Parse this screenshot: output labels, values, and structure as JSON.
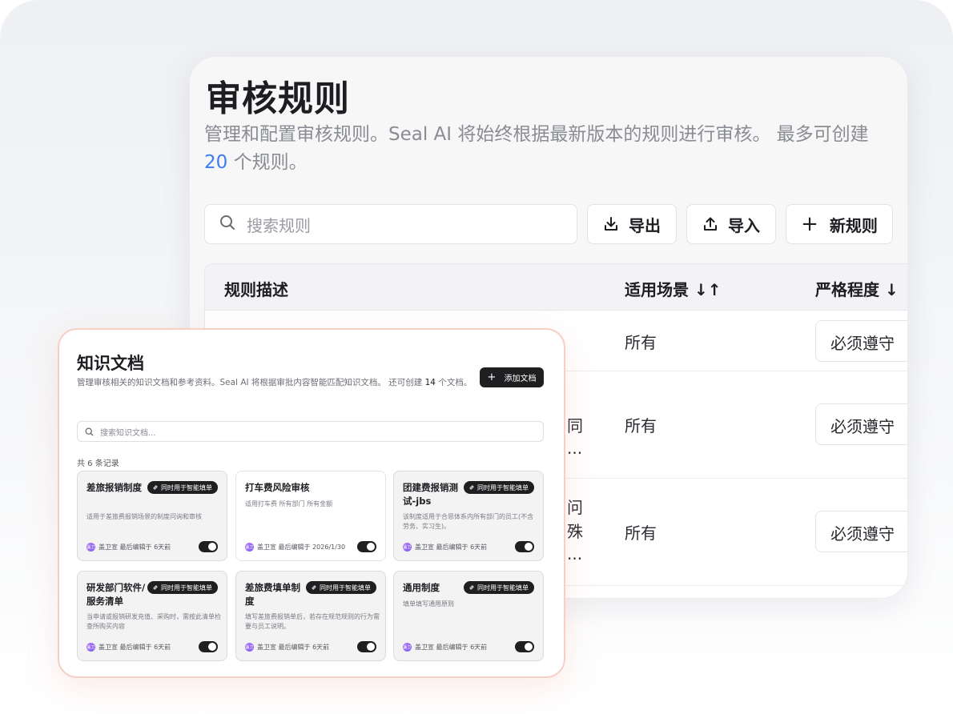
{
  "rules": {
    "title": "审核规则",
    "desc_line1": "管理和配置审核规则。Seal AI 将始终根据最新版本的规则进行审核。 最多可创建",
    "desc_count": "20",
    "desc_suffix": " 个规则。",
    "search_placeholder": "搜索规则",
    "export_label": "导出",
    "import_label": "导入",
    "new_label": "新规则",
    "new_plus": "+",
    "columns": {
      "desc": "规则描述",
      "scene": "适用场景 ↓↑",
      "level": "严格程度 ↓"
    },
    "rows": [
      {
        "scene": "所有",
        "level": "必须遵守"
      },
      {
        "scene": "所有",
        "level": "必须遵守",
        "desc_frag_1": "同",
        "desc_frag_2": "..."
      },
      {
        "scene": "所有",
        "level": "必须遵守",
        "desc_frag_1": "问",
        "desc_frag_2": "殊",
        "desc_frag_3": "..."
      }
    ]
  },
  "kb": {
    "title": "知识文档",
    "desc_a": "管理审核相关的知识文档和参考资料。Seal AI 将根据审批内容智能匹配知识文档。 还可创建 ",
    "desc_num": "14",
    "desc_b": " 个文档。",
    "add_label": "添加文档",
    "add_plus": "+",
    "search_placeholder": "搜索知识文档...",
    "count_text": "共 6 条记录",
    "badge_text": "同时用于智能填单",
    "avatar_initials": "盖卫",
    "docs": [
      {
        "title": "差旅报销制度",
        "sub": "适用于差旅费报销场景的制度问询和审核",
        "foot": "盖卫宣 最后编辑于 6天前"
      },
      {
        "title": "打车费风险审核",
        "sub": "适用打车费 所有部门 所有金额",
        "foot": "盖卫宣 最后编辑于 2026/1/30"
      },
      {
        "title": "团建费报销测试-jbs",
        "sub": "该制度适用于合思体系内所有部门的员工(不含劳务、实习生)。",
        "foot": "盖卫宣 最后编辑于 6天前"
      },
      {
        "title": "研发部门软件/服务清单",
        "sub": "当申请或报销研发充值、采购时，需按此清单检查所购买内容",
        "foot": "盖卫宣 最后编辑于 6天前"
      },
      {
        "title": "差旅费填单制度",
        "sub": "填写差旅费报销单后，若存在规范规则的行为需要与员工说明。",
        "foot": "盖卫宣 最后编辑于 6天前"
      },
      {
        "title": "通用制度",
        "sub": "填单填写通用原则",
        "foot": "盖卫宣 最后编辑于 6天前"
      }
    ]
  },
  "icons": [
    "search-icon",
    "download-icon",
    "upload-icon",
    "plus-icon",
    "link-icon",
    "toggle-switch"
  ]
}
